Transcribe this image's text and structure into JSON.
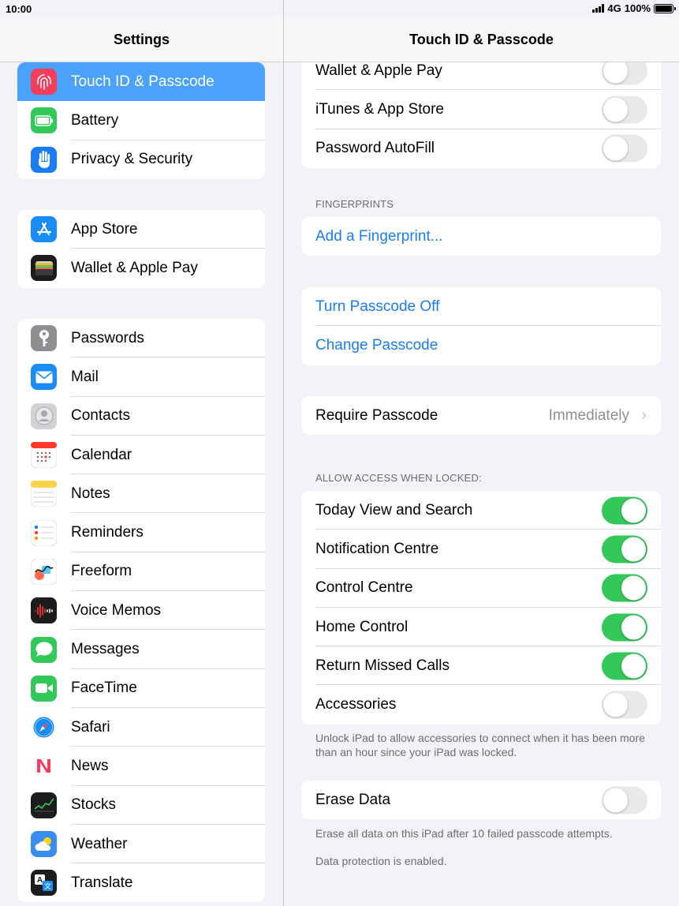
{
  "status": {
    "time": "10:00",
    "network": "4G",
    "battery": "100%"
  },
  "left": {
    "title": "Settings",
    "group1": [
      {
        "label": "Touch ID & Passcode",
        "icon": "fingerprint-icon",
        "color": "#f23d5c",
        "selected": true
      },
      {
        "label": "Battery",
        "icon": "battery-icon",
        "color": "#34c759"
      },
      {
        "label": "Privacy & Security",
        "icon": "hand-icon",
        "color": "#1a7ef2"
      }
    ],
    "group2": [
      {
        "label": "App Store",
        "icon": "app-store-icon",
        "color": "#1a8cf5"
      },
      {
        "label": "Wallet & Apple Pay",
        "icon": "wallet-icon",
        "color": "#1c1c1e"
      }
    ],
    "group3": [
      {
        "label": "Passwords",
        "icon": "key-icon",
        "color": "#8e8e93"
      },
      {
        "label": "Mail",
        "icon": "mail-icon",
        "color": "#1a8cf5"
      },
      {
        "label": "Contacts",
        "icon": "contacts-icon",
        "color": "#d1d1d6"
      },
      {
        "label": "Calendar",
        "icon": "calendar-icon",
        "color": "#ffffff"
      },
      {
        "label": "Notes",
        "icon": "notes-icon",
        "color": "#ffffff"
      },
      {
        "label": "Reminders",
        "icon": "reminders-icon",
        "color": "#ffffff"
      },
      {
        "label": "Freeform",
        "icon": "freeform-icon",
        "color": "#ffffff"
      },
      {
        "label": "Voice Memos",
        "icon": "voice-memos-icon",
        "color": "#1c1c1e"
      },
      {
        "label": "Messages",
        "icon": "messages-icon",
        "color": "#34c759"
      },
      {
        "label": "FaceTime",
        "icon": "facetime-icon",
        "color": "#34c759"
      },
      {
        "label": "Safari",
        "icon": "safari-icon",
        "color": "#ffffff"
      },
      {
        "label": "News",
        "icon": "news-icon",
        "color": "#ffffff"
      },
      {
        "label": "Stocks",
        "icon": "stocks-icon",
        "color": "#1c1c1e"
      },
      {
        "label": "Weather",
        "icon": "weather-icon",
        "color": "#3a8cf0"
      },
      {
        "label": "Translate",
        "icon": "translate-icon",
        "color": "#1c1c1e"
      }
    ]
  },
  "right": {
    "title": "Touch ID & Passcode",
    "top_rows": [
      {
        "label": "Wallet & Apple Pay",
        "on": false
      },
      {
        "label": "iTunes & App Store",
        "on": false
      },
      {
        "label": "Password AutoFill",
        "on": false
      }
    ],
    "fingerprints_header": "FINGERPRINTS",
    "add_fingerprint": "Add a Fingerprint...",
    "turn_passcode_off": "Turn Passcode Off",
    "change_passcode": "Change Passcode",
    "require_passcode": {
      "label": "Require Passcode",
      "value": "Immediately"
    },
    "allow_header": "ALLOW ACCESS WHEN LOCKED:",
    "allow_rows": [
      {
        "label": "Today View and Search",
        "on": true
      },
      {
        "label": "Notification Centre",
        "on": true
      },
      {
        "label": "Control Centre",
        "on": true
      },
      {
        "label": "Home Control",
        "on": true
      },
      {
        "label": "Return Missed Calls",
        "on": true
      },
      {
        "label": "Accessories",
        "on": false
      }
    ],
    "accessories_note": "Unlock iPad to allow accessories to connect when it has been more than an hour since your iPad was locked.",
    "erase_data": {
      "label": "Erase Data",
      "on": false
    },
    "erase_note": "Erase all data on this iPad after 10 failed passcode attempts.",
    "protection_note": "Data protection is enabled."
  }
}
